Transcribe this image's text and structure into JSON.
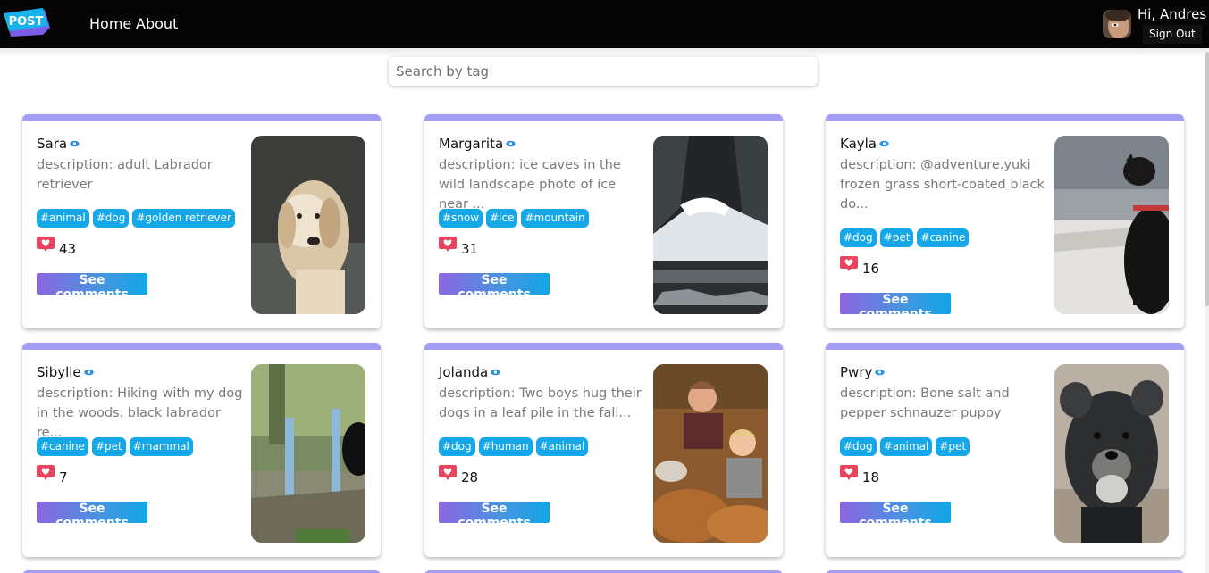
{
  "header": {
    "logo_text": "POST",
    "nav": [
      "Home",
      "About"
    ],
    "greeting": "Hi, Andres",
    "sign_out": "Sign Out"
  },
  "search": {
    "placeholder": "Search by tag",
    "value": ""
  },
  "colors": {
    "card_accent": "#a39ef4",
    "tag_bg": "#14a8e8",
    "heart": "#e8455f",
    "button_from": "#8b66e0",
    "button_to": "#0fa6e6"
  },
  "posts": [
    {
      "author": "Sara",
      "description": "description: adult Labrador retriever",
      "tags": [
        "#animal",
        "#dog",
        "#golden retriever"
      ],
      "likes": "43",
      "button": "See comments",
      "image": "golden retriever dog photo"
    },
    {
      "author": "Margarita",
      "description": "description: ice caves in the wild landscape photo of ice near ...",
      "tags": [
        "#snow",
        "#ice",
        "#mountain"
      ],
      "likes": "31",
      "button": "See comments",
      "image": "ice cave photo"
    },
    {
      "author": "Kayla",
      "description": "description: @adventure.yuki frozen grass short-coated black do...",
      "tags": [
        "#dog",
        "#pet",
        "#canine"
      ],
      "likes": "16",
      "button": "See comments",
      "image": "black dog on frozen grass photo"
    },
    {
      "author": "Sibylle",
      "description": "description: Hiking with my dog in the woods. black labrador re...",
      "tags": [
        "#canine",
        "#pet",
        "#mammal"
      ],
      "likes": "7",
      "button": "See comments",
      "image": "black labrador in woods photo"
    },
    {
      "author": "Jolanda",
      "description": "description: Two boys hug their dogs in a leaf pile in the fall...",
      "tags": [
        "#dog",
        "#human",
        "#animal"
      ],
      "likes": "28",
      "button": "See comments",
      "image": "two boys in leaf pile photo"
    },
    {
      "author": "Pwry",
      "description": "description: Bone salt and pepper schnauzer puppy",
      "tags": [
        "#dog",
        "#animal",
        "#pet"
      ],
      "likes": "18",
      "button": "See comments",
      "image": "schnauzer puppy photo"
    }
  ]
}
